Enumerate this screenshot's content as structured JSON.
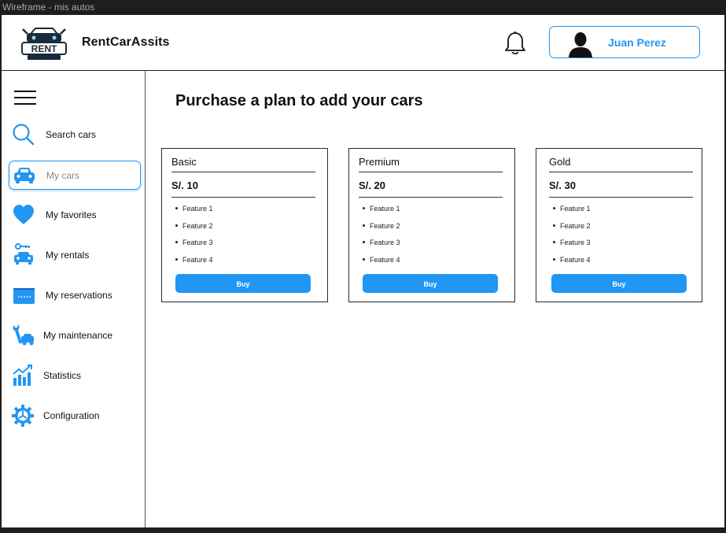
{
  "window": {
    "title": "Wireframe - mis autos"
  },
  "colors": {
    "accent": "#2196f3",
    "text": "#111111",
    "border": "#1f1f1f"
  },
  "header": {
    "brand": "RentCarAssits",
    "logo_icon": "rent-car-logo",
    "bell_icon": "bell-icon",
    "user": {
      "name": "Juan Perez",
      "avatar_icon": "user-avatar-icon"
    }
  },
  "sidebar": {
    "menu_icon": "hamburger-menu-icon",
    "items": [
      {
        "label": "Search cars",
        "icon": "search-icon",
        "active": false
      },
      {
        "label": "My cars",
        "icon": "car-icon",
        "active": true
      },
      {
        "label": "My favorites",
        "icon": "heart-icon",
        "active": false
      },
      {
        "label": "My rentals",
        "icon": "car-key-icon",
        "active": false
      },
      {
        "label": "My reservations",
        "icon": "reservation-card-icon",
        "active": false
      },
      {
        "label": "My maintenance",
        "icon": "wrench-car-icon",
        "active": false
      },
      {
        "label": "Statistics",
        "icon": "statistics-chart-icon",
        "active": false
      },
      {
        "label": "Configuration",
        "icon": "gear-icon",
        "active": false
      }
    ]
  },
  "main": {
    "title": "Purchase a plan to add your cars",
    "plans": [
      {
        "name": "Basic",
        "price": "S/. 10",
        "features": [
          "Feature 1",
          "Feature 2",
          "Feature 3",
          "Feature 4"
        ],
        "button": "Buy"
      },
      {
        "name": "Premium",
        "price": "S/. 20",
        "features": [
          "Feature 1",
          "Feature 2",
          "Feature 3",
          "Feature 4"
        ],
        "button": "Buy"
      },
      {
        "name": "Gold",
        "price": "S/. 30",
        "features": [
          "Feature 1",
          "Feature 2",
          "Feature 3",
          "Feature 4"
        ],
        "button": "Buy"
      }
    ]
  }
}
